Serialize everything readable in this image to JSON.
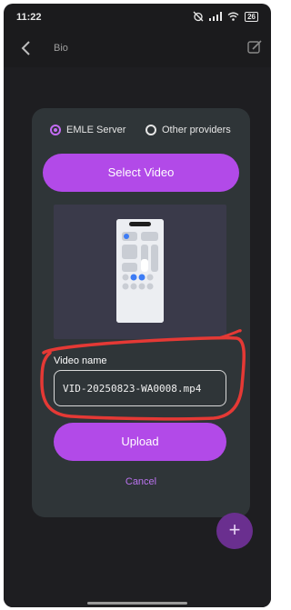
{
  "status_bar": {
    "time": "11:22",
    "battery": "26"
  },
  "app_bar": {
    "title": "Bio"
  },
  "dialog": {
    "providers": [
      {
        "label": "EMLE Server",
        "selected": true
      },
      {
        "label": "Other providers",
        "selected": false
      }
    ],
    "select_video_label": "Select Video",
    "video_name_label": "Video name",
    "video_name_value": "VID-20250823-WA0008.mp4",
    "upload_label": "Upload",
    "cancel_label": "Cancel"
  },
  "fab": {
    "icon": "plus-icon",
    "glyph": "+"
  },
  "colors": {
    "accent": "#b24ae8",
    "dialog_bg": "#2f3538",
    "annotation": "#e53935"
  }
}
